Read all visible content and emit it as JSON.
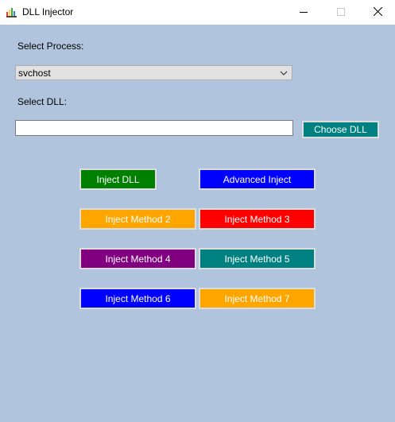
{
  "window": {
    "title": "DLL Injector"
  },
  "process": {
    "label": "Select Process:",
    "selected": "svchost"
  },
  "dll": {
    "label": "Select DLL:",
    "value": "",
    "choose_label": "Choose DLL"
  },
  "buttons": {
    "inject_dll": "Inject DLL",
    "advanced_inject": "Advanced Inject",
    "method2": "Inject Method 2",
    "method3": "Inject Method 3",
    "method4": "Inject Method 4",
    "method5": "Inject Method 5",
    "method6": "Inject Method 6",
    "method7": "Inject Method 7"
  },
  "colors": {
    "background": "#b0c4de",
    "green": "#008000",
    "blue": "#0000ff",
    "orange": "#ffa500",
    "red": "#ff0000",
    "purple": "#800080",
    "teal": "#008080"
  },
  "icons": {
    "app": "app-icon",
    "minimize": "minimize-icon",
    "maximize": "maximize-icon",
    "close": "close-icon",
    "dropdown": "chevron-down-icon"
  }
}
